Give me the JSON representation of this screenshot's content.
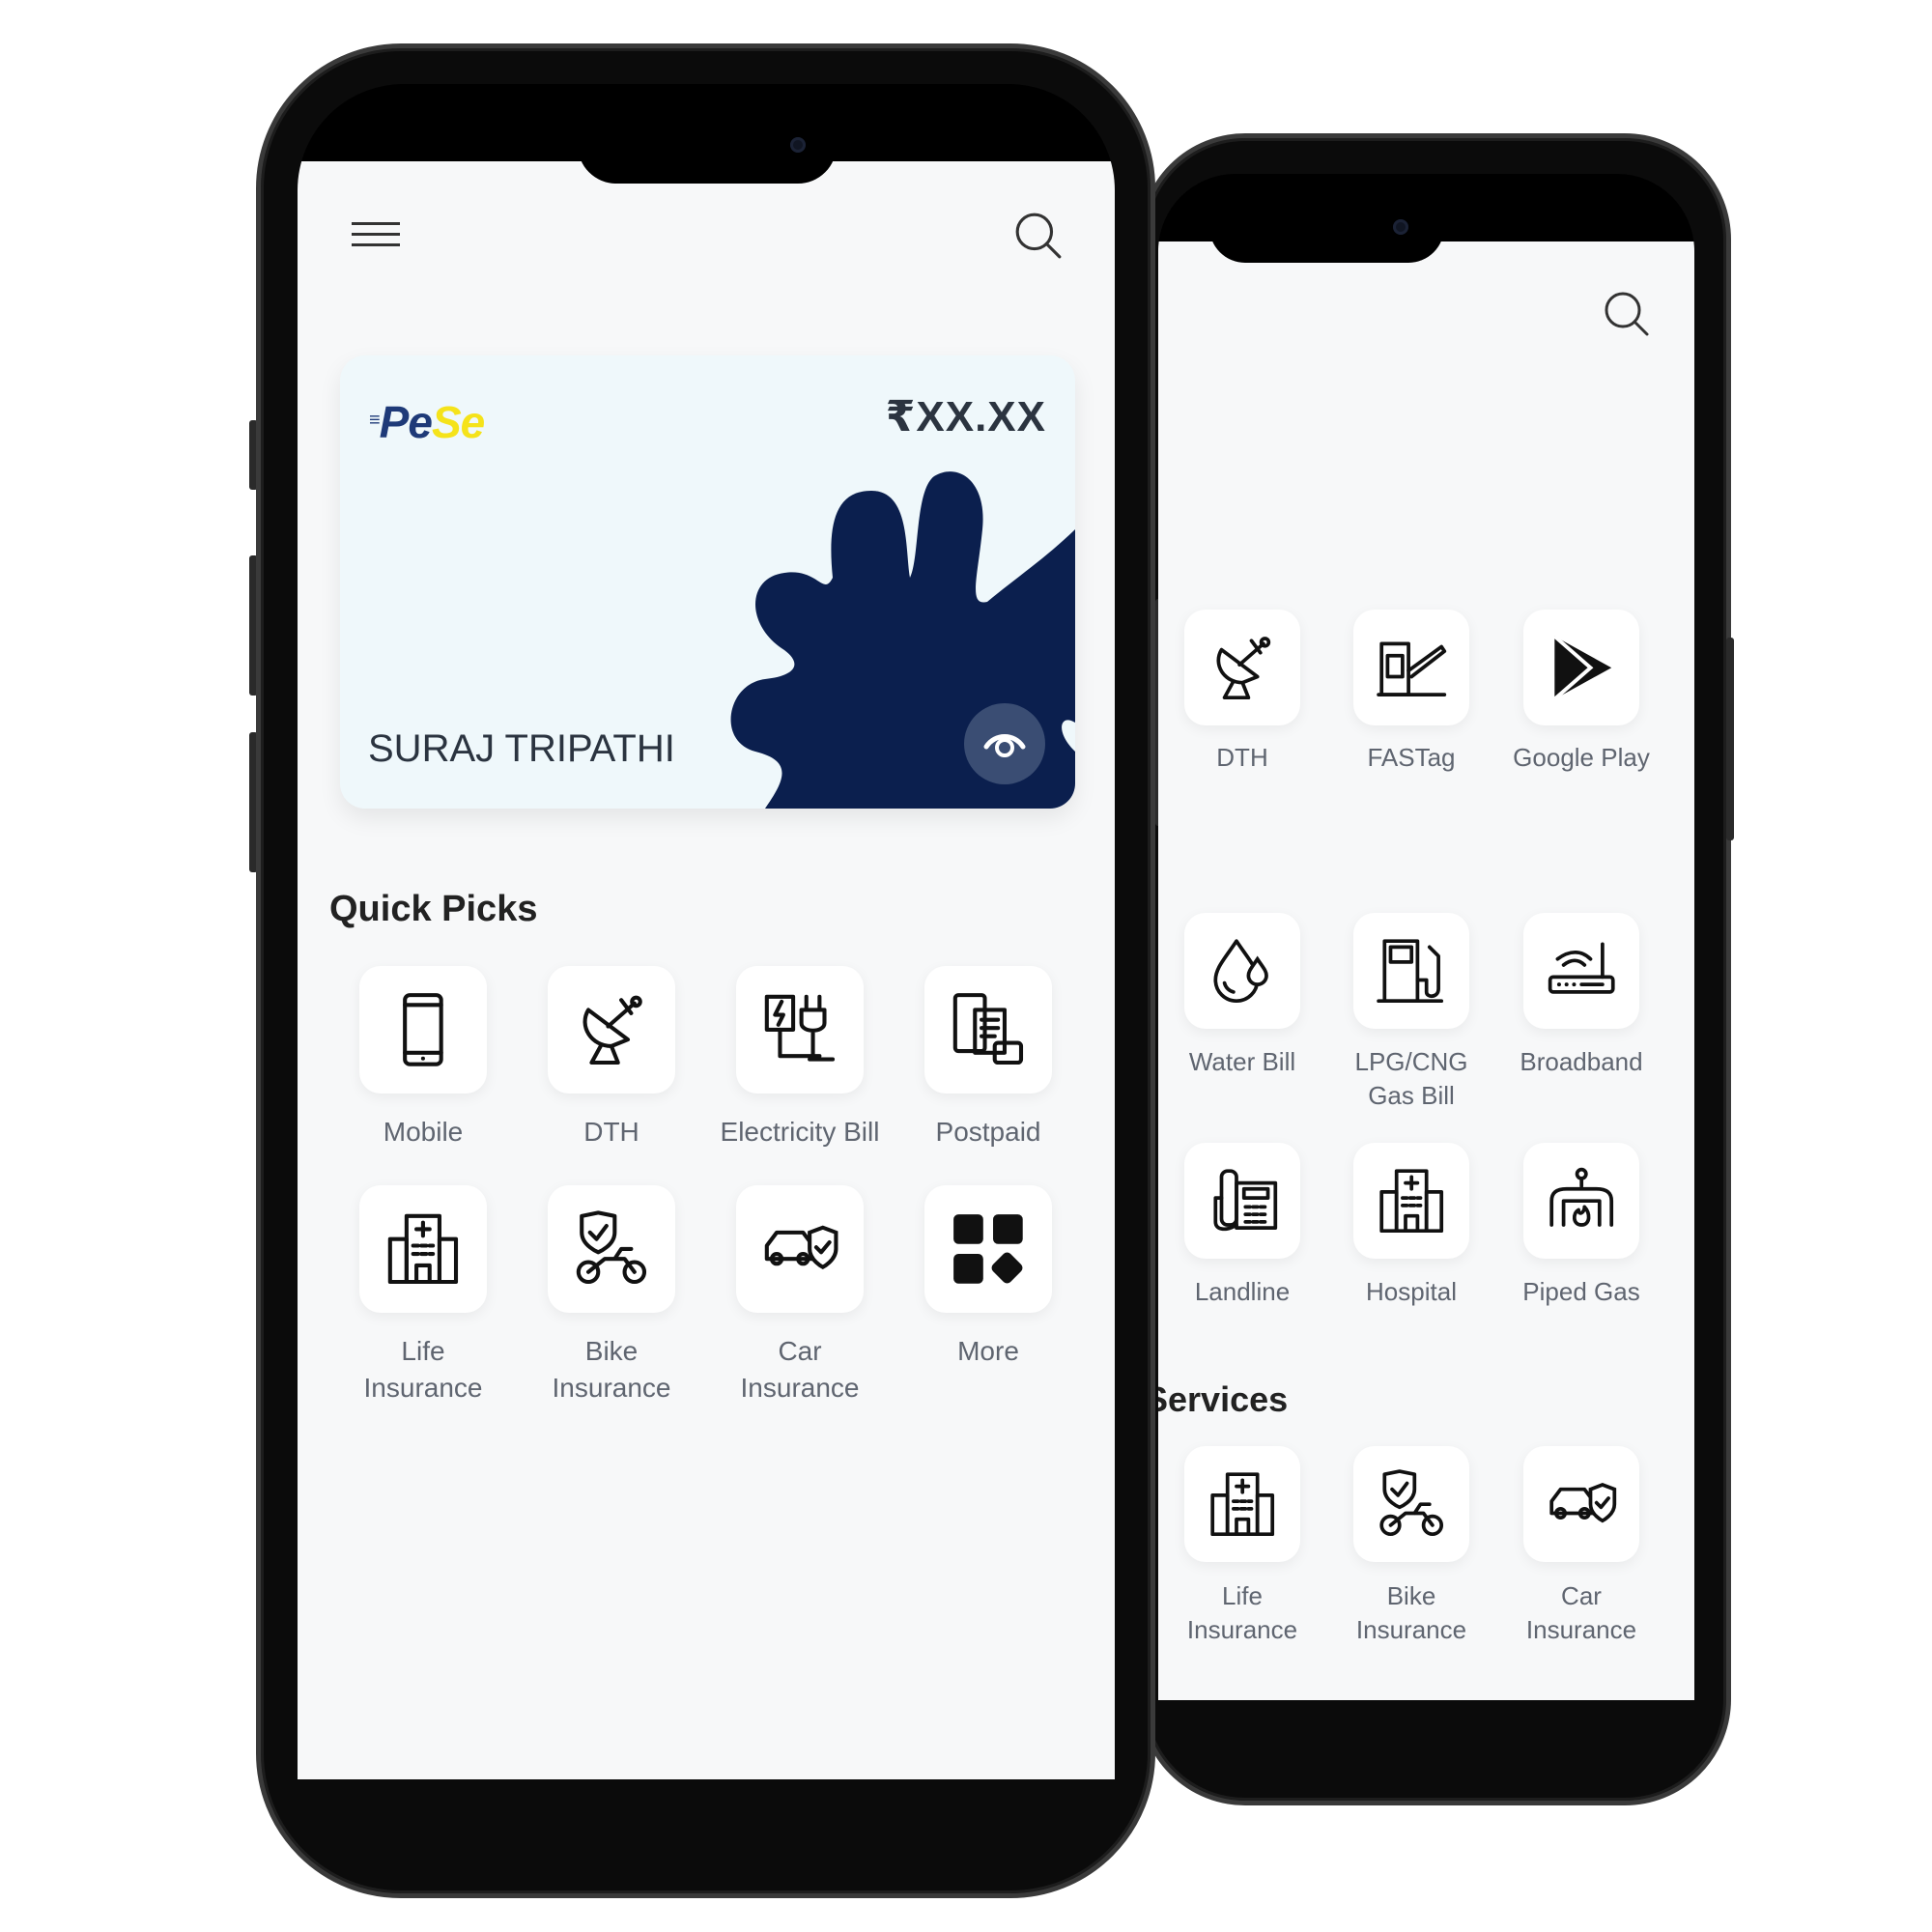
{
  "back_screen": {
    "search_icon": "search-icon",
    "services_heading": "Services",
    "rows": [
      [
        {
          "label": "DTH",
          "icon": "satellite-dish"
        },
        {
          "label": "FASTag",
          "icon": "toll-gate"
        },
        {
          "label": "Google Play",
          "icon": "play-store"
        }
      ],
      [
        {
          "label": "Water Bill",
          "icon": "water-drop"
        },
        {
          "label": "LPG/CNG\nGas Bill",
          "icon": "fuel-pump"
        },
        {
          "label": "Broadband",
          "icon": "router"
        }
      ],
      [
        {
          "label": "Landline",
          "icon": "telephone"
        },
        {
          "label": "Hospital",
          "icon": "hospital"
        },
        {
          "label": "Piped Gas",
          "icon": "gas-pipe"
        }
      ],
      [
        {
          "label": "Life\nInsurance",
          "icon": "hospital"
        },
        {
          "label": "Bike\nInsurance",
          "icon": "bike-shield"
        },
        {
          "label": "Car\nInsurance",
          "icon": "car-shield"
        }
      ]
    ]
  },
  "front_screen": {
    "menu_icon": "hamburger-icon",
    "search_icon": "search-icon",
    "card": {
      "logo_pe": "Pe",
      "logo_se": "Se",
      "balance": "₹XX.XX",
      "holder_name": "SURAJ TRIPATHI",
      "eye_icon": "eye-icon",
      "background": "#eff8fb",
      "blob_color": "#0b1f4e"
    },
    "quick_picks_title": "Quick Picks",
    "quick_picks": [
      {
        "label": "Mobile",
        "icon": "mobile"
      },
      {
        "label": "DTH",
        "icon": "satellite-dish"
      },
      {
        "label": "Electricity Bill",
        "icon": "electricity"
      },
      {
        "label": "Postpaid",
        "icon": "postpaid"
      },
      {
        "label": "Life\nInsurance",
        "icon": "hospital"
      },
      {
        "label": "Bike\nInsurance",
        "icon": "bike-shield"
      },
      {
        "label": "Car\nInsurance",
        "icon": "car-shield"
      },
      {
        "label": "More",
        "icon": "more-grid"
      }
    ]
  },
  "colors": {
    "logo_blue": "#1e3a78",
    "logo_yellow": "#f5e31a",
    "text": "#2b3440",
    "label": "#5f6570"
  }
}
